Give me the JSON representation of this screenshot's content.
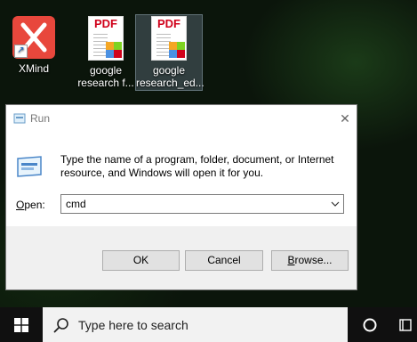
{
  "desktop": {
    "icons": [
      {
        "label": "XMind",
        "icon": "xmind-icon"
      },
      {
        "label": "google research f...",
        "icon": "pdf-file-icon",
        "file_badge": "PDF"
      },
      {
        "label": "google research_ed...",
        "icon": "pdf-file-icon",
        "file_badge": "PDF",
        "selected": true
      }
    ]
  },
  "run_dialog": {
    "title": "Run",
    "description": "Type the name of a program, folder, document, or Internet resource, and Windows will open it for you.",
    "open_label_prefix": "",
    "open_label_accel": "O",
    "open_label_rest": "pen:",
    "command_value": "cmd",
    "buttons": {
      "ok": "OK",
      "cancel": "Cancel",
      "browse_accel": "B",
      "browse_rest": "rowse..."
    }
  },
  "taskbar": {
    "search_placeholder": "Type here to search"
  },
  "colors": {
    "xmind": "#e8473c",
    "pdf_red": "#d0021b",
    "taskbar": "#101010",
    "dialog_footer": "#f0f0f0"
  }
}
